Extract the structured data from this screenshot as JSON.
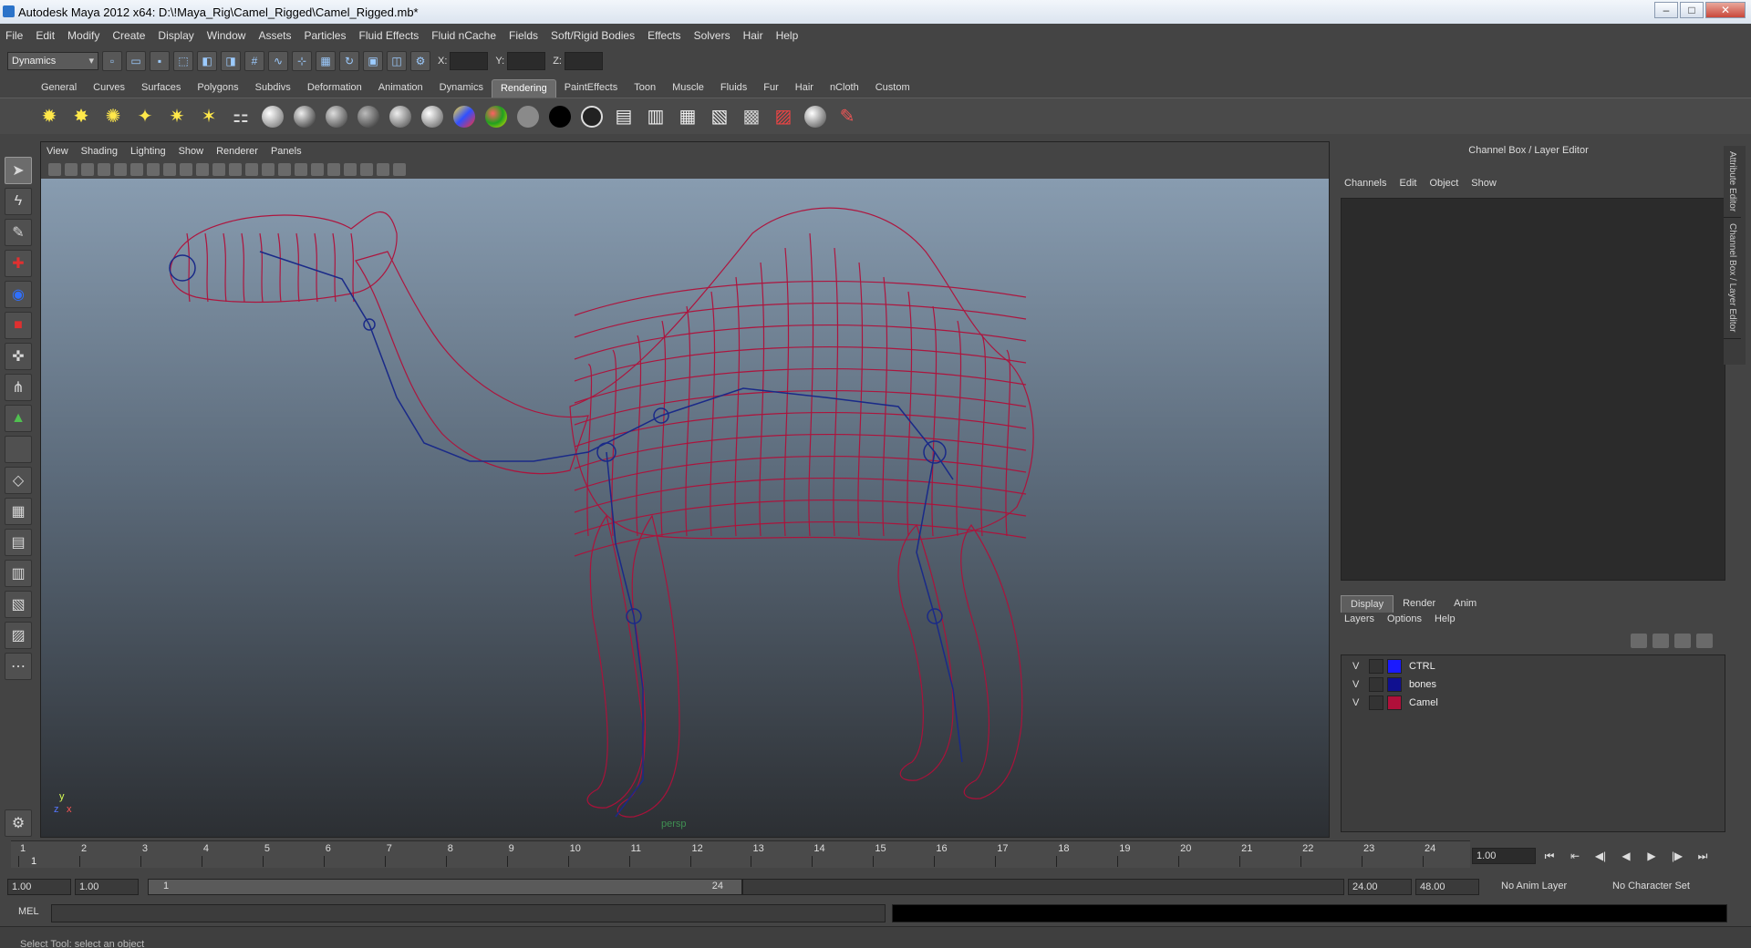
{
  "window": {
    "title": "Autodesk Maya 2012 x64: D:\\!Maya_Rig\\Camel_Rigged\\Camel_Rigged.mb*",
    "minimize": "–",
    "maximize": "□",
    "close": "✕"
  },
  "menubar": {
    "items": [
      "File",
      "Edit",
      "Modify",
      "Create",
      "Display",
      "Window",
      "Assets",
      "Particles",
      "Fluid Effects",
      "Fluid nCache",
      "Fields",
      "Soft/Rigid Bodies",
      "Effects",
      "Solvers",
      "Hair",
      "Help"
    ]
  },
  "statusline": {
    "mode": "Dynamics",
    "x_label": "X:",
    "y_label": "Y:",
    "z_label": "Z:"
  },
  "shelf": {
    "tabs": [
      "General",
      "Curves",
      "Surfaces",
      "Polygons",
      "Subdivs",
      "Deformation",
      "Animation",
      "Dynamics",
      "Rendering",
      "PaintEffects",
      "Toon",
      "Muscle",
      "Fluids",
      "Fur",
      "Hair",
      "nCloth",
      "Custom"
    ],
    "active_tab": "Rendering"
  },
  "viewport": {
    "menu": [
      "View",
      "Shading",
      "Lighting",
      "Show",
      "Renderer",
      "Panels"
    ],
    "camera_label": "persp",
    "axis_y": "y",
    "axis_x": "x",
    "axis_z": "z",
    "mesh_color": "#b0103a",
    "bone_color": "#1a2a88"
  },
  "channelbox": {
    "title": "Channel Box / Layer Editor",
    "menu": [
      "Channels",
      "Edit",
      "Object",
      "Show"
    ],
    "layer_tabs": [
      "Display",
      "Render",
      "Anim"
    ],
    "layer_menu": [
      "Layers",
      "Options",
      "Help"
    ],
    "layers": [
      {
        "vis": "V",
        "name": "CTRL",
        "color": "#1a1aff"
      },
      {
        "vis": "V",
        "name": "bones",
        "color": "#101090"
      },
      {
        "vis": "V",
        "name": "Camel",
        "color": "#b0103a"
      }
    ]
  },
  "sidetabs": [
    "Attribute Editor",
    "Channel Box / Layer Editor"
  ],
  "timeline": {
    "ticks": [
      "1",
      "2",
      "3",
      "4",
      "5",
      "6",
      "7",
      "8",
      "9",
      "10",
      "11",
      "12",
      "13",
      "14",
      "15",
      "16",
      "17",
      "18",
      "19",
      "20",
      "21",
      "22",
      "23",
      "24"
    ],
    "current_frame": "1",
    "current_time_field": "1.00"
  },
  "range": {
    "start_time": "1.00",
    "playback_start": "1.00",
    "slider_low": "1",
    "slider_high": "24",
    "playback_end": "24.00",
    "end_time": "48.00",
    "anim_layer": "No Anim Layer",
    "character_set": "No Character Set"
  },
  "playback": {
    "go_start": "⏮",
    "step_back_key": "⇤",
    "step_back": "◀|",
    "play_back": "◀",
    "play_fwd": "▶",
    "step_fwd": "|▶",
    "go_end": "⏭"
  },
  "commandline": {
    "lang": "MEL"
  },
  "helpline": {
    "text": "Select Tool: select an object"
  }
}
